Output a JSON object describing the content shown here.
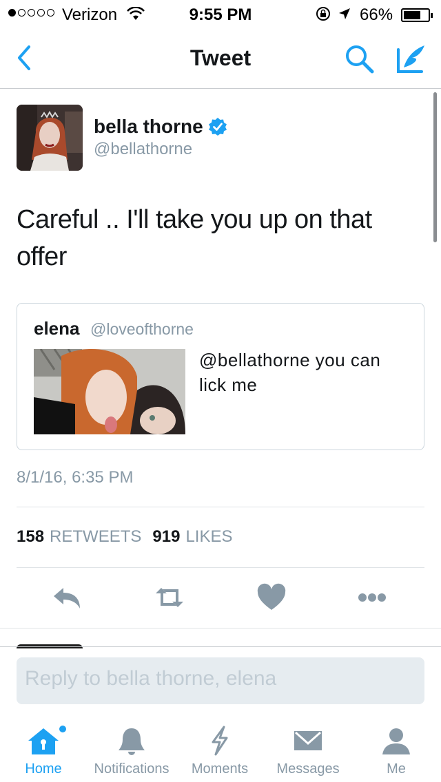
{
  "status_bar": {
    "carrier": "Verizon",
    "time": "9:55 PM",
    "battery": "66%",
    "battery_level": 0.66
  },
  "nav": {
    "title": "Tweet"
  },
  "tweet": {
    "author_name": "bella thorne",
    "author_handle": "@bellathorne",
    "text": "Careful .. I'll take you up on that offer",
    "timestamp": "8/1/16, 6:35 PM",
    "retweet_count": "158",
    "retweet_label": "RETWEETS",
    "like_count": "919",
    "like_label": "LIKES"
  },
  "quote": {
    "author_name": "elena",
    "author_handle": "@loveofthorne",
    "text": "@bellathorne you can lick me"
  },
  "reply": {
    "placeholder": "Reply to bella thorne, elena"
  },
  "tabs": [
    {
      "label": "Home",
      "icon": "home-icon",
      "active": true
    },
    {
      "label": "Notifications",
      "icon": "bell-icon",
      "active": false
    },
    {
      "label": "Moments",
      "icon": "lightning-icon",
      "active": false
    },
    {
      "label": "Messages",
      "icon": "envelope-icon",
      "active": false
    },
    {
      "label": "Me",
      "icon": "person-icon",
      "active": false
    }
  ],
  "colors": {
    "accent": "#1da1f2",
    "secondary_text": "#8899a6",
    "icon_gray": "#8899a6"
  }
}
